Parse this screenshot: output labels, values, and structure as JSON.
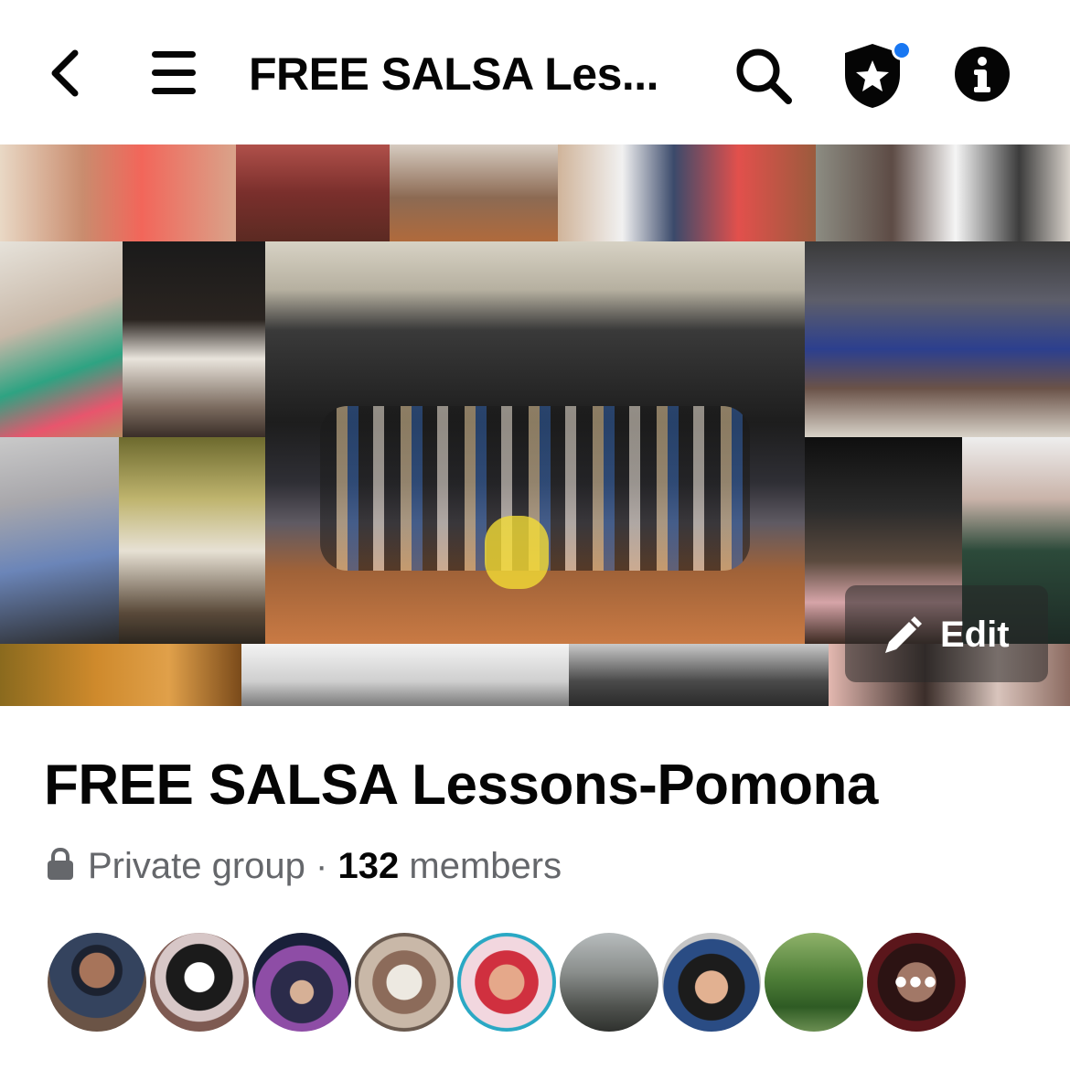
{
  "header": {
    "title": "FREE SALSA Les..."
  },
  "icons": {
    "back": "chevron-left-icon",
    "menu": "hamburger-menu-icon",
    "search": "search-icon",
    "admin": "shield-star-icon",
    "info": "info-icon",
    "edit": "pencil-icon",
    "privacy": "lock-icon"
  },
  "cover": {
    "edit_label": "Edit"
  },
  "group": {
    "name": "FREE SALSA Lessons-Pomona",
    "privacy": "Private group",
    "separator": "·",
    "member_count": "132",
    "members_label": "members"
  },
  "members_preview": {
    "more_label": "•••"
  },
  "colors": {
    "accent_dot": "#1877f2",
    "text_primary": "#050505",
    "text_secondary": "#65676b"
  }
}
